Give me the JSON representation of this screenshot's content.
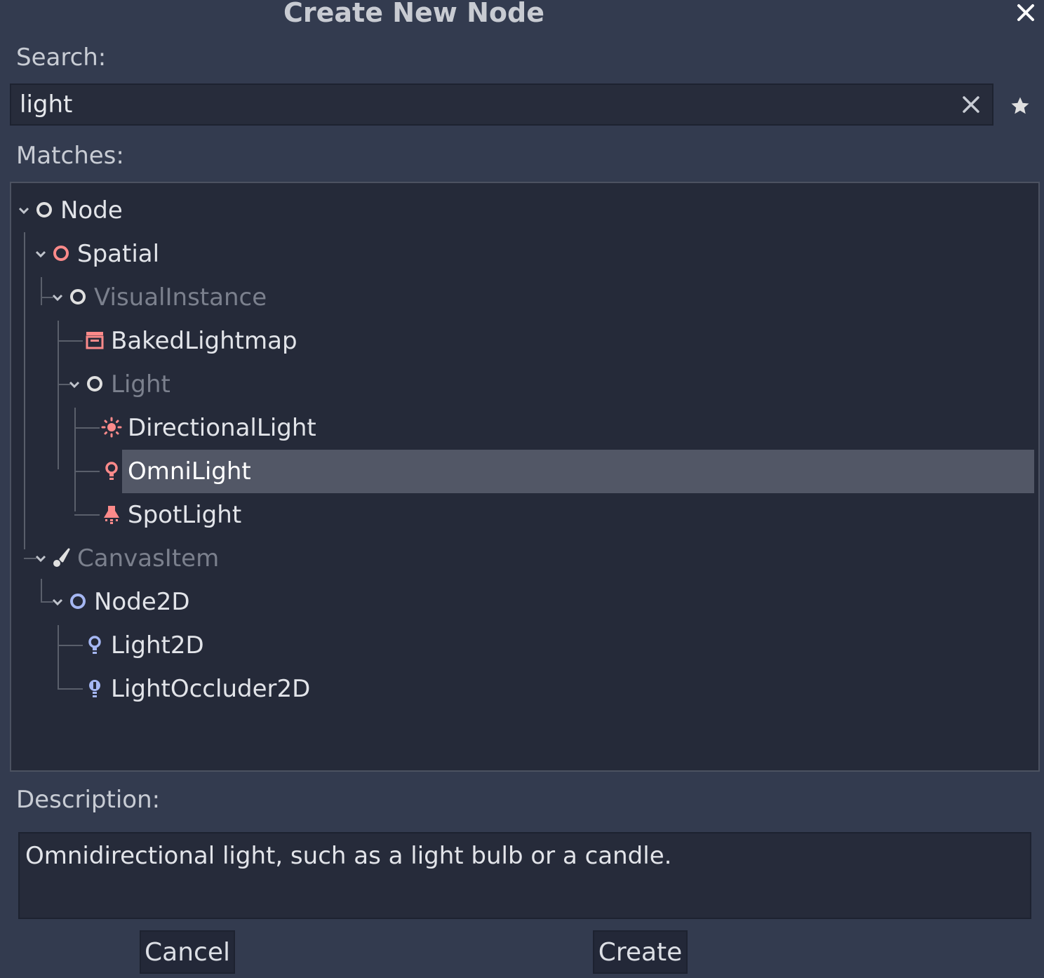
{
  "dialog": {
    "title": "Create New Node",
    "search_label": "Search:",
    "search_value": "light",
    "matches_label": "Matches:",
    "description_label": "Description:",
    "description_text": "Omnidirectional light, such as a light bulb or a candle.",
    "cancel_label": "Cancel",
    "create_label": "Create"
  },
  "tree": {
    "selected": "OmniLight",
    "items": [
      {
        "label": "Node",
        "depth": 0,
        "expanded": true,
        "dimmed": false,
        "icon": "node-icon"
      },
      {
        "label": "Spatial",
        "depth": 1,
        "expanded": true,
        "dimmed": false,
        "icon": "spatial-icon"
      },
      {
        "label": "VisualInstance",
        "depth": 2,
        "expanded": true,
        "dimmed": true,
        "icon": "visual-instance-icon"
      },
      {
        "label": "BakedLightmap",
        "depth": 3,
        "expanded": false,
        "dimmed": false,
        "icon": "baked-lightmap-icon"
      },
      {
        "label": "Light",
        "depth": 3,
        "expanded": true,
        "dimmed": true,
        "icon": "light-icon"
      },
      {
        "label": "DirectionalLight",
        "depth": 4,
        "expanded": false,
        "dimmed": false,
        "icon": "directional-light-icon"
      },
      {
        "label": "OmniLight",
        "depth": 4,
        "expanded": false,
        "dimmed": false,
        "icon": "omni-light-icon"
      },
      {
        "label": "SpotLight",
        "depth": 4,
        "expanded": false,
        "dimmed": false,
        "icon": "spot-light-icon"
      },
      {
        "label": "CanvasItem",
        "depth": 1,
        "expanded": true,
        "dimmed": true,
        "icon": "canvas-item-icon"
      },
      {
        "label": "Node2D",
        "depth": 2,
        "expanded": true,
        "dimmed": false,
        "icon": "node2d-icon"
      },
      {
        "label": "Light2D",
        "depth": 3,
        "expanded": false,
        "dimmed": false,
        "icon": "light2d-icon"
      },
      {
        "label": "LightOccluder2D",
        "depth": 3,
        "expanded": false,
        "dimmed": false,
        "icon": "light-occluder2d-icon"
      }
    ]
  },
  "colors": {
    "background": "#333b4f",
    "tree_background": "#252a39",
    "selection": "#525766",
    "spatial_red": "#fc8a8a",
    "canvas_blue": "#a5b7f3",
    "node_white": "#e0e0e0"
  }
}
